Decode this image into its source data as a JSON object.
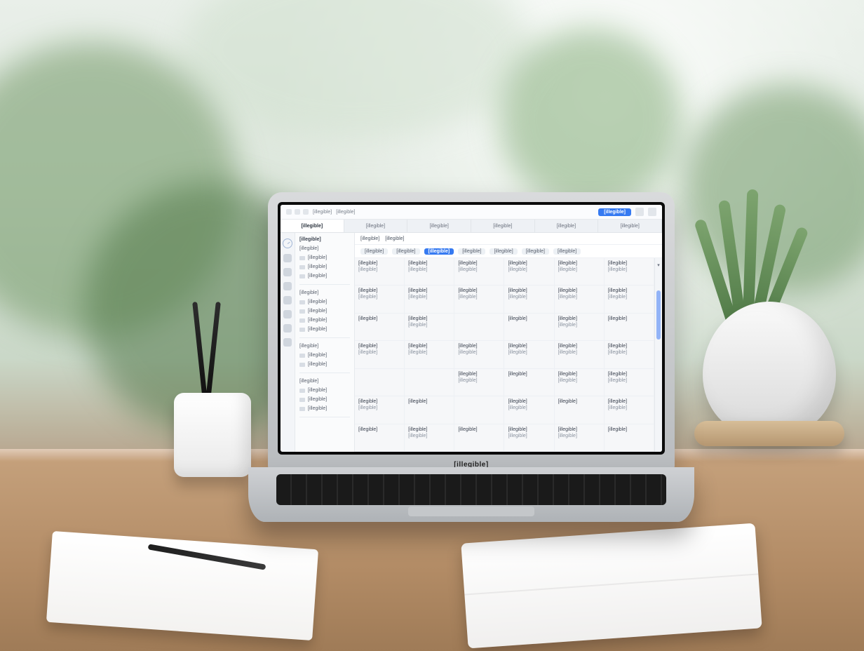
{
  "note": "Photograph of a laptop on a wooden desk surrounded by houseplants, a pen cup, notebooks and a pen. The laptop screen shows a light-themed web application with a left icon rail, a narrow sidebar list, a tab strip, a filter chip row and a multi-column data grid. All on-screen text is too small and blurred in the photo to read; labels below are placeholders marked [illegible].",
  "laptop": {
    "brand_label": "[illegible]"
  },
  "app": {
    "titlebar": {
      "title": "[illegible]",
      "subtitle": "[illegible]",
      "primary_button": "[illegible]"
    },
    "tabs": [
      "[illegible]",
      "[illegible]",
      "[illegible]",
      "[illegible]",
      "[illegible]",
      "[illegible]"
    ],
    "tabs_active_index": 0,
    "sidebar": {
      "heading": "[illegible]",
      "groups": [
        {
          "label": "[illegible]",
          "items": [
            "[illegible]",
            "[illegible]",
            "[illegible]"
          ]
        },
        {
          "label": "[illegible]",
          "items": [
            "[illegible]",
            "[illegible]",
            "[illegible]",
            "[illegible]"
          ]
        },
        {
          "label": "[illegible]",
          "items": [
            "[illegible]",
            "[illegible]"
          ]
        },
        {
          "label": "[illegible]",
          "items": [
            "[illegible]",
            "[illegible]",
            "[illegible]"
          ]
        }
      ]
    },
    "breadcrumbs": [
      "[illegible]",
      "[illegible]"
    ],
    "filters": {
      "chips": [
        "[illegible]",
        "[illegible]",
        "[illegible]",
        "[illegible]",
        "[illegible]",
        "[illegible]",
        "[illegible]"
      ],
      "selected_index": 2
    },
    "grid": {
      "columns": 6,
      "rows": [
        [
          {
            "l1": "[illegible]",
            "l2": "[illegible]"
          },
          {
            "l1": "[illegible]",
            "l2": "[illegible]"
          },
          {
            "l1": "[illegible]",
            "l2": "[illegible]"
          },
          {
            "l1": "[illegible]",
            "l2": "[illegible]"
          },
          {
            "l1": "[illegible]",
            "l2": "[illegible]"
          },
          {
            "l1": "[illegible]",
            "l2": "[illegible]"
          }
        ],
        [
          {
            "l1": "[illegible]",
            "l2": "[illegible]"
          },
          {
            "l1": "[illegible]",
            "l2": "[illegible]"
          },
          {
            "l1": "[illegible]",
            "l2": "[illegible]"
          },
          {
            "l1": "[illegible]",
            "l2": "[illegible]"
          },
          {
            "l1": "[illegible]",
            "l2": "[illegible]"
          },
          {
            "l1": "[illegible]",
            "l2": "[illegible]"
          }
        ],
        [
          {
            "l1": "[illegible]",
            "l2": ""
          },
          {
            "l1": "[illegible]",
            "l2": "[illegible]"
          },
          {
            "l1": "",
            "l2": ""
          },
          {
            "l1": "[illegible]",
            "l2": ""
          },
          {
            "l1": "[illegible]",
            "l2": "[illegible]"
          },
          {
            "l1": "[illegible]",
            "l2": ""
          }
        ],
        [
          {
            "l1": "[illegible]",
            "l2": "[illegible]"
          },
          {
            "l1": "[illegible]",
            "l2": "[illegible]"
          },
          {
            "l1": "[illegible]",
            "l2": "[illegible]"
          },
          {
            "l1": "[illegible]",
            "l2": "[illegible]"
          },
          {
            "l1": "[illegible]",
            "l2": "[illegible]"
          },
          {
            "l1": "[illegible]",
            "l2": "[illegible]"
          }
        ],
        [
          {
            "l1": "",
            "l2": ""
          },
          {
            "l1": "",
            "l2": ""
          },
          {
            "l1": "[illegible]",
            "l2": "[illegible]"
          },
          {
            "l1": "[illegible]",
            "l2": ""
          },
          {
            "l1": "[illegible]",
            "l2": "[illegible]"
          },
          {
            "l1": "[illegible]",
            "l2": "[illegible]"
          }
        ],
        [
          {
            "l1": "[illegible]",
            "l2": "[illegible]"
          },
          {
            "l1": "[illegible]",
            "l2": ""
          },
          {
            "l1": "",
            "l2": ""
          },
          {
            "l1": "[illegible]",
            "l2": "[illegible]"
          },
          {
            "l1": "[illegible]",
            "l2": ""
          },
          {
            "l1": "[illegible]",
            "l2": "[illegible]"
          }
        ],
        [
          {
            "l1": "[illegible]",
            "l2": ""
          },
          {
            "l1": "[illegible]",
            "l2": "[illegible]"
          },
          {
            "l1": "[illegible]",
            "l2": ""
          },
          {
            "l1": "[illegible]",
            "l2": "[illegible]"
          },
          {
            "l1": "[illegible]",
            "l2": "[illegible]"
          },
          {
            "l1": "[illegible]",
            "l2": ""
          }
        ]
      ]
    }
  }
}
